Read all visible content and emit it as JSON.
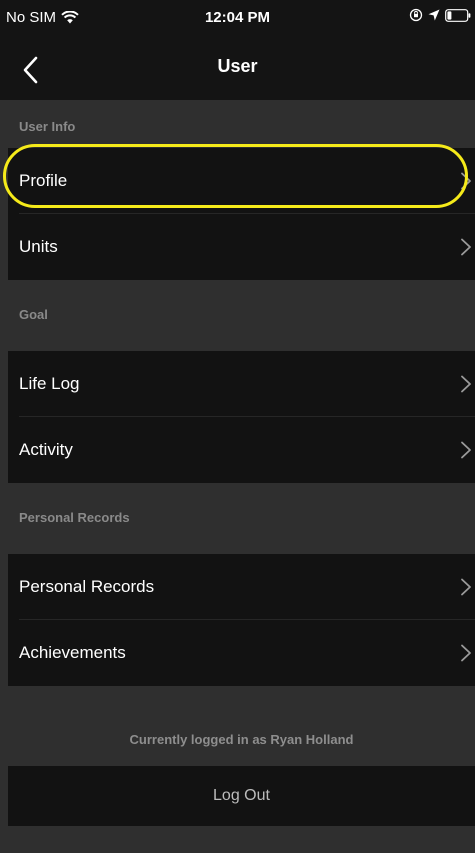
{
  "status_bar": {
    "carrier": "No SIM",
    "time": "12:04 PM",
    "icons": [
      "wifi-icon",
      "orientation-lock-icon",
      "location-arrow-icon",
      "battery-icon"
    ]
  },
  "nav": {
    "title": "User",
    "back_icon": "chevron-left-icon"
  },
  "sections": [
    {
      "header": "User Info",
      "items": [
        {
          "label": "Profile"
        },
        {
          "label": "Units"
        }
      ]
    },
    {
      "header": "Goal",
      "items": [
        {
          "label": "Life Log"
        },
        {
          "label": "Activity"
        }
      ]
    },
    {
      "header": "Personal Records",
      "items": [
        {
          "label": "Personal Records"
        },
        {
          "label": "Achievements"
        }
      ]
    }
  ],
  "account": {
    "logged_in_text": "Currently logged in as Ryan Holland",
    "logout_label": "Log Out"
  },
  "colors": {
    "background": "#2f2f2f",
    "row_background": "#121212",
    "highlight": "#f5ea1a",
    "section_header_text": "#8a8a8a",
    "chevron": "#9a9a9a"
  }
}
